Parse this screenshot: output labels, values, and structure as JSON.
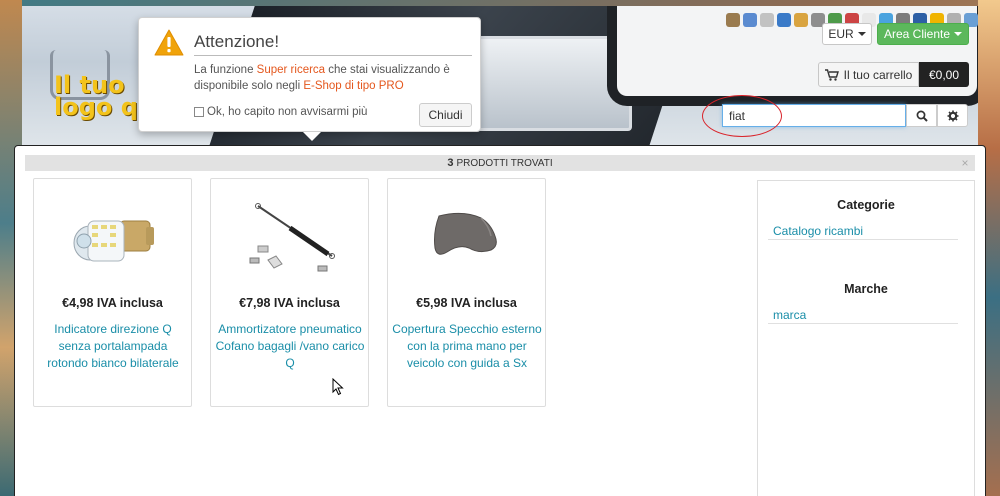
{
  "header": {
    "logo_text": "Il tuo\nlogo q",
    "currency": {
      "label": "EUR"
    },
    "area_cliente": {
      "label": "Area Cliente"
    },
    "cart": {
      "label": "Il tuo carrello",
      "total": "€0,00"
    },
    "search": {
      "value": "fiat",
      "search_icon": "search-icon",
      "settings_icon": "gear-icon"
    },
    "accent_color": "#5cb85c"
  },
  "popover": {
    "title": "Attenzione!",
    "text_part1": "La funzione ",
    "highlight1": "Super ricerca",
    "text_part2": " che stai visualizzando è disponibile solo negli ",
    "highlight2": "E-Shop di tipo PRO",
    "checkbox_label": "Ok, ho capito non avvisarmi più",
    "close_label": "Chiudi",
    "icon": "warning-icon",
    "highlight_color": "#e4571d"
  },
  "results": {
    "count": "3",
    "label": "PRODOTTI TROVATI",
    "close_glyph": "×",
    "products": [
      {
        "price": "€4,98 IVA inclusa",
        "name": "Indicatore direzione Q senza portalampada rotondo bianco bilaterale",
        "icon": "led-bulb-image"
      },
      {
        "price": "€7,98 IVA inclusa",
        "name": "Ammortizatore pneumatico Cofano bagagli /vano carico Q",
        "icon": "gas-spring-image"
      },
      {
        "price": "€5,98 IVA inclusa",
        "name": "Copertura Specchio esterno con la prima mano per veicolo con guida a Sx",
        "icon": "mirror-cover-image"
      }
    ],
    "sidebar": {
      "categories_title": "Categorie",
      "categories": [
        "Catalogo ricambi"
      ],
      "brands_title": "Marche",
      "brands": [
        "marca"
      ]
    },
    "link_color": "#1a8ea8"
  }
}
